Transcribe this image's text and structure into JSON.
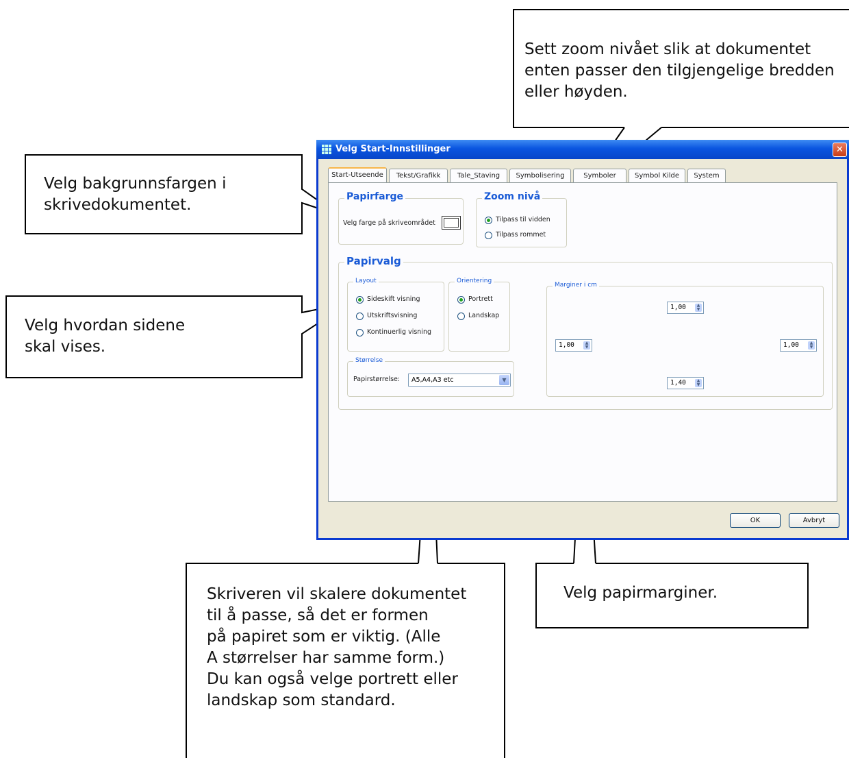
{
  "callouts": {
    "zoom": "Sett zoom nivået slik at dokumentet\nenten passer den tilgjengelige bredden\neller høyden.",
    "background": "Velg bakgrunnsfargen i\nskrivedokumentet.",
    "pages": "Velg hvordan sidene\nskal vises.",
    "printer": "Skriveren vil skalere dokumentet\ntil å passe, så det er formen\npå papiret som er viktig. (Alle\nA størrelser har samme form.)\nDu kan også velge portrett eller\nlandskap som standard.",
    "margins": "Velg papirmarginer."
  },
  "dialog": {
    "title": "Velg Start-Innstillinger",
    "close": "✕",
    "tabs": [
      "Start-Utseende",
      "Tekst/Grafikk",
      "Tale_Staving",
      "Symbolisering",
      "Symboler",
      "Symbol Kilde",
      "System"
    ],
    "active_tab": 0,
    "paper_color": {
      "legend": "Papirfarge",
      "label": "Velg farge på skriveområdet"
    },
    "zoom": {
      "legend": "Zoom nivå",
      "options": [
        "Tilpass til vidden",
        "Tilpass rommet"
      ],
      "selected": 0
    },
    "paper": {
      "legend": "Papirvalg",
      "layout": {
        "legend": "Layout",
        "options": [
          "Sideskift visning",
          "Utskriftsvisning",
          "Kontinuerlig visning"
        ],
        "selected": 0
      },
      "orientation": {
        "legend": "Orientering",
        "options": [
          "Portrett",
          "Landskap"
        ],
        "selected": 0
      },
      "size": {
        "legend": "Størrelse",
        "label": "Papirstørrelse:",
        "value": "A5,A4,A3 etc"
      },
      "margins": {
        "legend": "Marginer i cm",
        "top": "1,00",
        "left": "1,00",
        "right": "1,00",
        "bottom": "1,40"
      }
    },
    "ok": "OK",
    "cancel": "Avbryt"
  }
}
